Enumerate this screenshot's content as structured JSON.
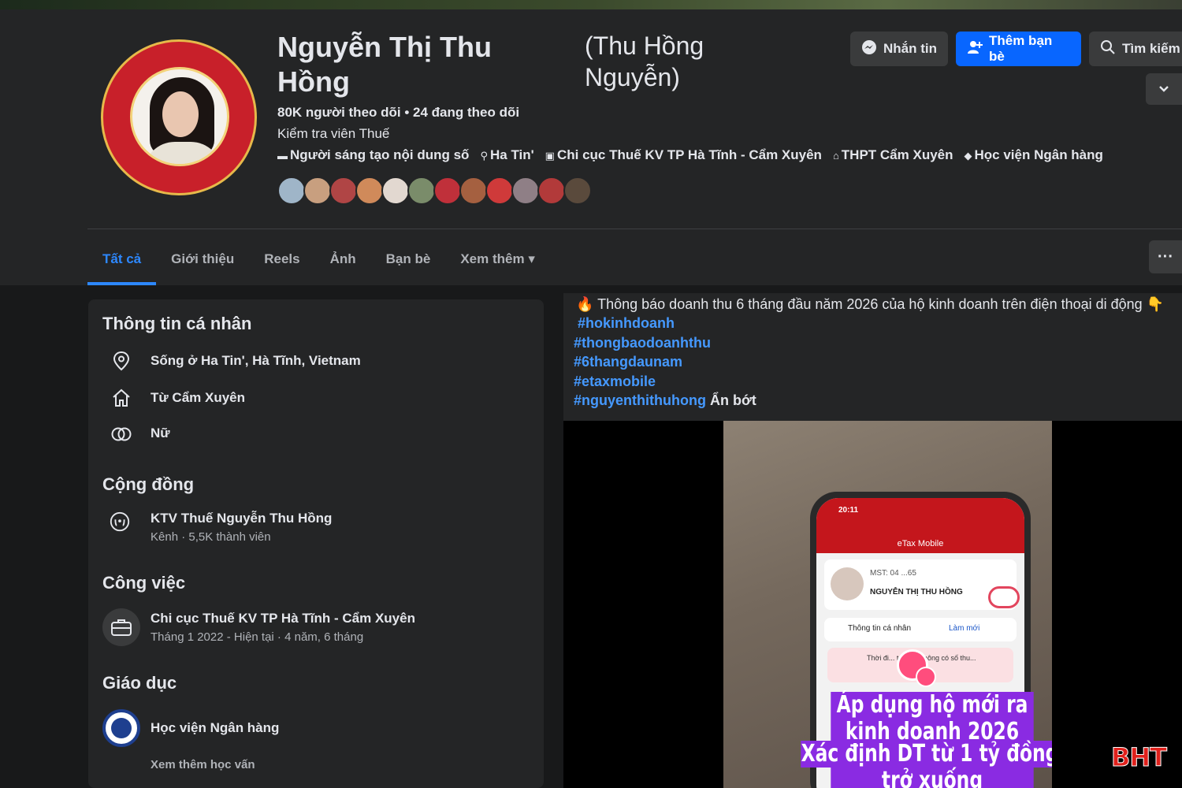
{
  "profile": {
    "name": "Nguyễn Thị Thu Hồng",
    "alt_name": "(Thu Hồng Nguyễn)",
    "follow_stats": "80K người theo dõi • 24 đang theo dõi",
    "title": "Kiểm tra viên Thuế",
    "info": [
      {
        "icon": "category-icon",
        "text": "Người sáng tạo nội dung số"
      },
      {
        "icon": "location-pin-icon",
        "text": "Ha Tin'"
      },
      {
        "icon": "workplace-icon",
        "text": "Chi cục Thuế KV TP Hà Tĩnh - Cẩm Xuyên"
      },
      {
        "icon": "school-icon",
        "text": "THPT Cẩm Xuyên"
      },
      {
        "icon": "graduation-cap-icon",
        "text": "Học viện Ngân hàng"
      }
    ],
    "friend_avatar_count": 12
  },
  "actions": {
    "message": "Nhắn tin",
    "add_friend": "Thêm bạn bè",
    "search": "Tìm kiếm"
  },
  "tabs": [
    {
      "label": "Tất cả",
      "active": true
    },
    {
      "label": "Giới thiệu"
    },
    {
      "label": "Reels"
    },
    {
      "label": "Ảnh"
    },
    {
      "label": "Bạn bè"
    },
    {
      "label": "Xem thêm ▾"
    }
  ],
  "intro": {
    "personal_title": "Thông tin cá nhân",
    "lives_in": "Sống ở Ha Tin', Hà Tĩnh, Vietnam",
    "from": "Từ Cẩm Xuyên",
    "gender": "Nữ",
    "community_title": "Cộng đồng",
    "community_name": "KTV Thuế Nguyễn Thu Hồng",
    "community_sub": "Kênh · 5,5K thành viên",
    "work_title": "Công việc",
    "work_name": "Chi cục Thuế KV TP Hà Tĩnh - Cẩm Xuyên",
    "work_sub": "Tháng 1 2022 - Hiện tại · 4 năm, 6 tháng",
    "edu_title": "Giáo dục",
    "edu_name": "Học viện Ngân hàng",
    "edu_more": "Xem thêm học vấn"
  },
  "post": {
    "text": "Thông báo doanh thu 6 tháng đầu năm 2026 của hộ kinh doanh trên điện thoại di động",
    "tags": [
      "#hokinhdoanh",
      "#thongbaodoanhthu",
      "#6thangdaunam",
      "#etaxmobile",
      "#nguyenthithuhong"
    ],
    "collapse": "Ẩn bớt",
    "video": {
      "status_time": "20:11",
      "app_title": "eTax Mobile",
      "mst": "MST: 04 ...65",
      "user_name": "NGUYỄN THỊ THU HỒNG",
      "info_label": "Thông tin cá nhân",
      "refresh": "Làm mới",
      "notice": "Thời đi... tại bạn không có số thu...",
      "captions": [
        "Áp dụng hộ mới ra",
        "kinh doanh 2026",
        "Xác định DT từ 1 tỷ đồng",
        "trở xuống"
      ],
      "watermark": "BHT"
    }
  },
  "colors": {
    "accent": "#2d88ff",
    "primary_button": "#0866ff",
    "hashtag": "#4599ff",
    "caption_bg": "#8a2be2"
  }
}
